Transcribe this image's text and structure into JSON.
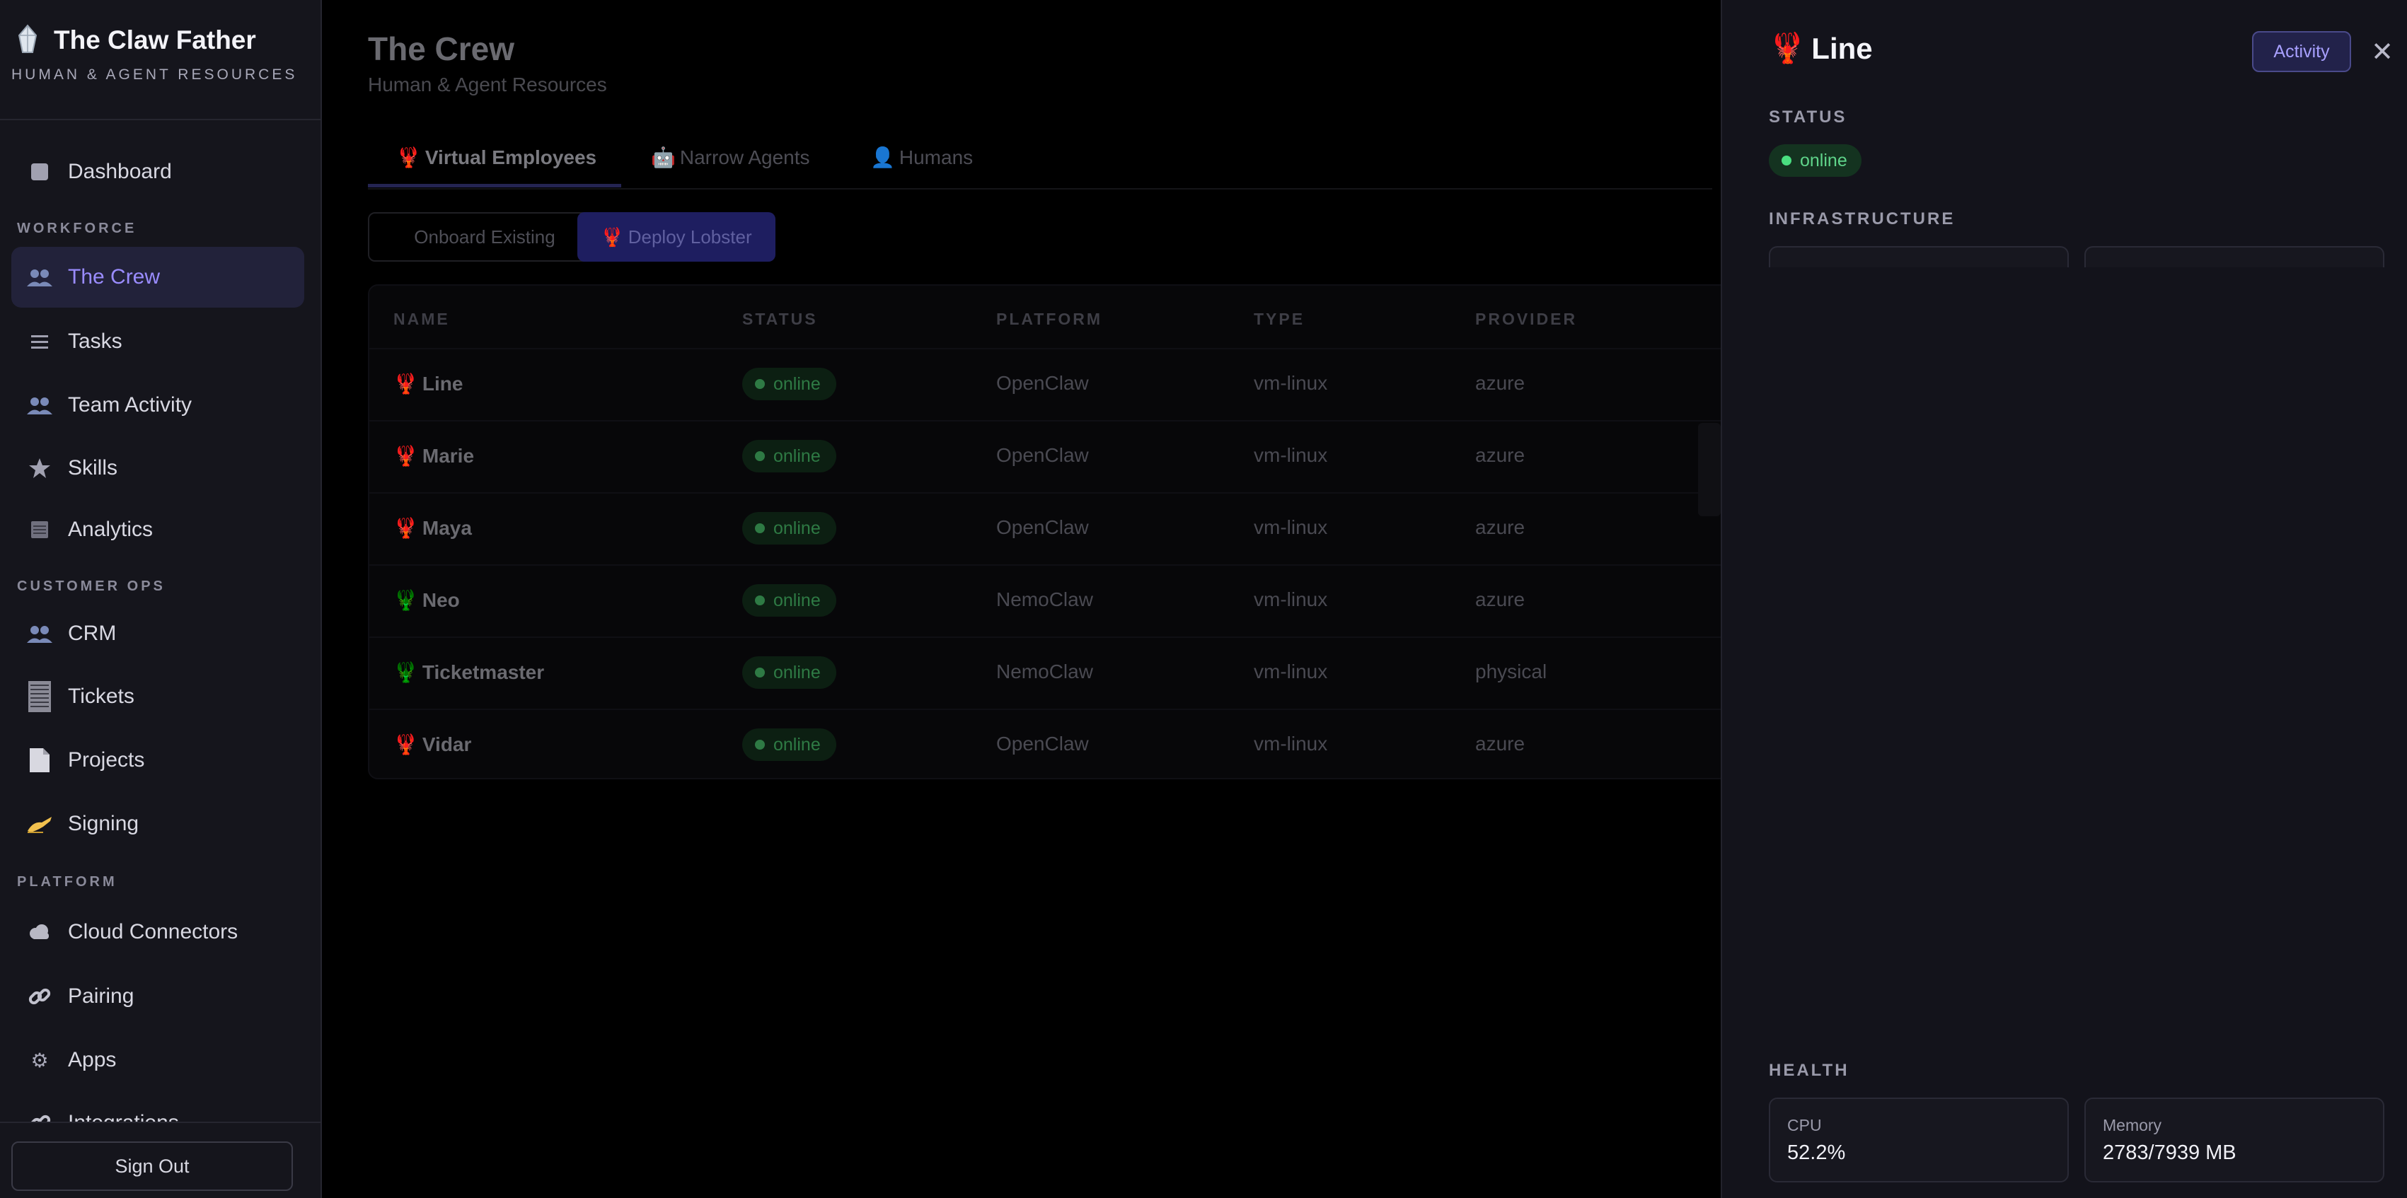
{
  "brand": {
    "title": "The Claw Father",
    "subtitle": "HUMAN & AGENT RESOURCES"
  },
  "sidebar": {
    "items": [
      {
        "label": "Dashboard",
        "icon": "square-icon"
      },
      {
        "label": "The Crew",
        "icon": "people-icon",
        "active": true
      },
      {
        "label": "Tasks",
        "icon": "list-icon"
      },
      {
        "label": "Team Activity",
        "icon": "people-icon"
      },
      {
        "label": "Skills",
        "icon": "star-icon"
      },
      {
        "label": "Analytics",
        "icon": "table-icon"
      },
      {
        "label": "CRM",
        "icon": "people-icon"
      },
      {
        "label": "Tickets",
        "icon": "ledger-icon"
      },
      {
        "label": "Projects",
        "icon": "document-icon"
      },
      {
        "label": "Signing",
        "icon": "writing-hand-icon"
      },
      {
        "label": "Cloud Connectors",
        "icon": "cloud-icon"
      },
      {
        "label": "Pairing",
        "icon": "link-icon"
      },
      {
        "label": "Apps",
        "icon": "gear-icon"
      },
      {
        "label": "Integrations",
        "icon": "link-icon"
      }
    ],
    "sections": {
      "workforce": "WORKFORCE",
      "customer_ops": "CUSTOMER OPS",
      "platform": "PLATFORM"
    },
    "sign_out": "Sign Out"
  },
  "main": {
    "title": "The Crew",
    "subtitle": "Human & Agent Resources",
    "tabs": [
      {
        "label": "Virtual Employees",
        "icon": "lobster-icon",
        "active": true
      },
      {
        "label": "Narrow Agents",
        "icon": "robot-icon"
      },
      {
        "label": "Humans",
        "icon": "person-icon"
      }
    ],
    "buttons": {
      "onboard": "Onboard Existing",
      "deploy": "Deploy Lobster"
    },
    "table": {
      "headers": [
        "NAME",
        "STATUS",
        "PLATFORM",
        "TYPE",
        "PROVIDER"
      ],
      "rows": [
        {
          "name": "Line",
          "icon_color": "#e05a3a",
          "status": "online",
          "platform": "OpenClaw",
          "type": "vm-linux",
          "provider": "azure"
        },
        {
          "name": "Marie",
          "icon_color": "#e05a3a",
          "status": "online",
          "platform": "OpenClaw",
          "type": "vm-linux",
          "provider": "azure"
        },
        {
          "name": "Maya",
          "icon_color": "#e05a3a",
          "status": "online",
          "platform": "OpenClaw",
          "type": "vm-linux",
          "provider": "azure"
        },
        {
          "name": "Neo",
          "icon_color": "#4caf50",
          "status": "online",
          "platform": "NemoClaw",
          "type": "vm-linux",
          "provider": "azure"
        },
        {
          "name": "Ticketmaster",
          "icon_color": "#4caf50",
          "status": "online",
          "platform": "NemoClaw",
          "type": "vm-linux",
          "provider": "physical"
        },
        {
          "name": "Vidar",
          "icon_color": "#e05a3a",
          "status": "online",
          "platform": "OpenClaw",
          "type": "vm-linux",
          "provider": "azure"
        }
      ]
    }
  },
  "panel": {
    "title": "Line",
    "activity_button": "Activity",
    "close": "✕",
    "status_section": "STATUS",
    "status": "online",
    "infrastructure_section": "INFRASTRUCTURE",
    "health_section": "HEALTH",
    "metrics": [
      {
        "label": "CPU",
        "value": "52.2%"
      },
      {
        "label": "Memory",
        "value": "2783/7939 MB"
      }
    ]
  },
  "colors": {
    "accent": "#9a8cff",
    "online": "#4ade80",
    "lobster": "#e05a3a",
    "nemo": "#4caf50"
  }
}
